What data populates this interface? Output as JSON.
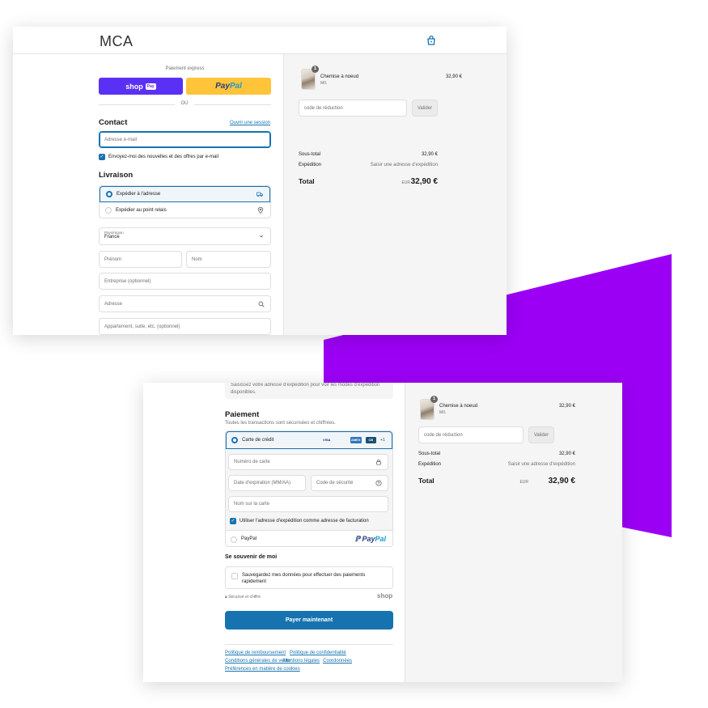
{
  "colors": {
    "purple_accent": "#9b00f5",
    "primary_blue": "#1773b0",
    "shop_pay": "#5a31f4",
    "paypal_yellow": "#ffc439"
  },
  "store": {
    "name": "MCA",
    "cart_icon": "shopping-bag-icon"
  },
  "express": {
    "title": "Paiement express",
    "shop_label": "shop",
    "shop_chip": "Pay",
    "paypal_pay": "Pay",
    "paypal_pal": "Pal",
    "or": "OU"
  },
  "contact": {
    "title": "Contact",
    "login_link": "Ouvrir une session",
    "email_placeholder": "Adresse e-mail",
    "newsletter_label": "Envoyez-moi des nouvelles et des offres par e-mail"
  },
  "delivery": {
    "title": "Livraison",
    "options": [
      {
        "label": "Expédier à l'adresse",
        "icon": "truck-icon",
        "selected": true
      },
      {
        "label": "Expédier au point relais",
        "icon": "location-pin-icon",
        "selected": false
      }
    ],
    "country_label": "Pays/région",
    "country_value": "France",
    "first_name": "Prénom",
    "last_name": "Nom",
    "company": "Entreprise (optionnel)",
    "address": "Adresse",
    "apartment": "Appartement, suite, etc. (optionnel)"
  },
  "summary": {
    "item_name": "Chemise à noeud",
    "item_variant": "M/L",
    "item_qty": "1",
    "item_price": "32,90 €",
    "discount_placeholder": "code de réduction",
    "discount_button": "Valider",
    "subtotal_label": "Sous-total",
    "subtotal_value": "32,90 €",
    "shipping_label": "Expédition",
    "shipping_value": "Saisir une adresse d'expédition",
    "total_label": "Total",
    "total_currency": "EUR",
    "total_value": "32,90 €"
  },
  "payment": {
    "note": "Saisissez votre adresse d'expédition pour voir les modes d'expédition disponibles.",
    "title": "Paiement",
    "subtitle": "Toutes les transactions sont sécurisées et chiffrées.",
    "card_label": "Carte de crédit",
    "card_brands": [
      "VISA",
      "MC",
      "AMEX",
      "CB"
    ],
    "more_brands": "+1",
    "card_number": "Numéro de carte",
    "expiry": "Date d'expiration (MM/AA)",
    "cvc": "Code de sécurité",
    "name_on_card": "Nom sur la carte",
    "billing_same": "Utiliser l'adresse d'expédition comme adresse de facturation",
    "paypal_label": "PayPal"
  },
  "remember": {
    "title": "Se souvenir de moi",
    "checkbox_label": "Sauvegardez mes données pour effectuer des paiements rapidement",
    "secure": "Sécurisé et chiffré",
    "shop_logo": "shop"
  },
  "pay_button": "Payer maintenant",
  "footer_links": [
    "Politique de remboursement",
    "Politique de confidentialité",
    "Conditions générales de vente",
    "Mentions légales",
    "Coordonnées",
    "Préférences en matière de cookies"
  ]
}
